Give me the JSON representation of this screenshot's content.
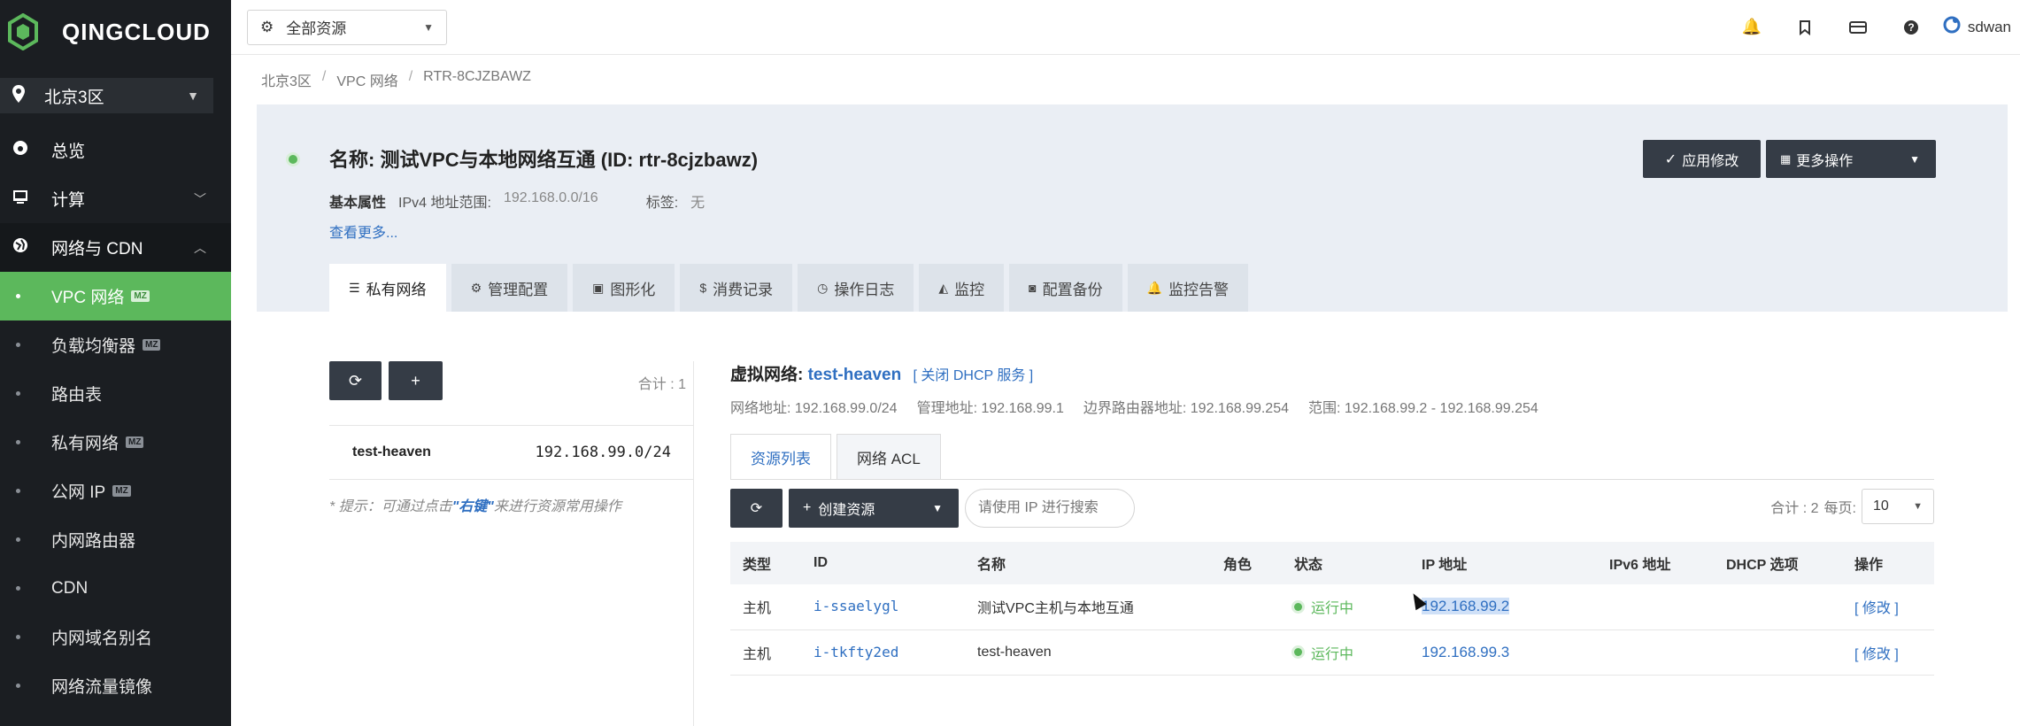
{
  "app": {
    "logo_text": "QINGCLOUD"
  },
  "zone": {
    "label": "北京3区"
  },
  "sidebar": {
    "groups": [
      {
        "label": "总览"
      },
      {
        "label": "计算"
      },
      {
        "label": "网络与 CDN"
      }
    ],
    "items": [
      {
        "label": "VPC 网络",
        "badge": "MZ"
      },
      {
        "label": "负载均衡器",
        "badge": "MZ"
      },
      {
        "label": "路由表"
      },
      {
        "label": "私有网络",
        "badge": "MZ"
      },
      {
        "label": "公网 IP",
        "badge": "MZ"
      },
      {
        "label": "内网路由器"
      },
      {
        "label": "CDN"
      },
      {
        "label": "内网域名别名"
      },
      {
        "label": "网络流量镜像"
      }
    ]
  },
  "topbar": {
    "resource_select": "全部资源",
    "user": "sdwan"
  },
  "breadcrumb": [
    "北京3区",
    "VPC 网络",
    "RTR-8CJZBAWZ"
  ],
  "header": {
    "title": "名称: 测试VPC与本地网络互通 (ID: rtr-8cjzbawz)",
    "basic_props_label": "基本属性",
    "ipv4_label": "IPv4 地址范围:",
    "ipv4_value": "192.168.0.0/16",
    "tag_label": "标签:",
    "tag_value": "无",
    "see_more": "查看更多...",
    "apply_button": "应用修改",
    "more_button": "更多操作",
    "tabs": [
      "私有网络",
      "管理配置",
      "图形化",
      "消费记录",
      "操作日志",
      "监控",
      "配置备份",
      "监控告警"
    ]
  },
  "left_pane": {
    "total": "合计 : 1",
    "vnet_name": "test-heaven",
    "vnet_cidr": "192.168.99.0/24",
    "hint_prefix": "* 提示：可通过点击",
    "hint_em": "\"右键\"",
    "hint_suffix": "来进行资源常用操作"
  },
  "detail": {
    "vnet_label": "虚拟网络:",
    "vnet_name": "test-heaven",
    "dhcp_link": "[ 关闭 DHCP 服务 ]",
    "network_addr": "网络地址: 192.168.99.0/24",
    "manage_addr": "管理地址: 192.168.99.1",
    "border_addr": "边界路由器地址: 192.168.99.254",
    "range": "范围: 192.168.99.2 - 192.168.99.254",
    "subtabs": [
      "资源列表",
      "网络 ACL"
    ],
    "create_button": "创建资源",
    "search_placeholder": "请使用 IP 进行搜索",
    "total": "合计 : 2",
    "per_page_label": "每页:",
    "per_page_value": "10",
    "columns": [
      "类型",
      "ID",
      "名称",
      "角色",
      "状态",
      "IP 地址",
      "IPv6 地址",
      "DHCP 选项",
      "操作"
    ],
    "rows": [
      {
        "type": "主机",
        "id": "i-ssaelygl",
        "name": "测试VPC主机与本地互通",
        "role": "",
        "status": "运行中",
        "ip": "192.168.99.2",
        "ipv6": "",
        "dhcp": "",
        "action": "[ 修改 ]"
      },
      {
        "type": "主机",
        "id": "i-tkfty2ed",
        "name": "test-heaven",
        "role": "",
        "status": "运行中",
        "ip": "192.168.99.3",
        "ipv6": "",
        "dhcp": "",
        "action": "[ 修改 ]"
      }
    ]
  },
  "colors": {
    "accent_green": "#5cb85c",
    "link_blue": "#2f6fc1",
    "dark_button": "#353c46",
    "sidebar_bg": "#1b1e22"
  }
}
